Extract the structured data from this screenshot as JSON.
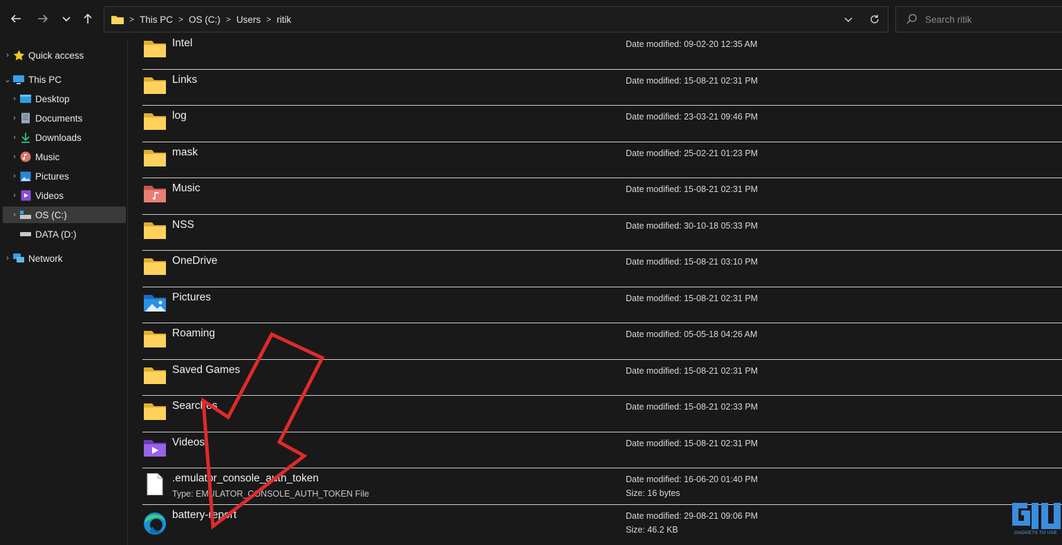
{
  "address": {
    "crumbs": [
      "This PC",
      "OS (C:)",
      "Users",
      "ritik"
    ]
  },
  "search": {
    "placeholder": "Search ritik"
  },
  "sidebar": {
    "quick_access": "Quick access",
    "this_pc": "This PC",
    "desktop": "Desktop",
    "documents": "Documents",
    "downloads": "Downloads",
    "music": "Music",
    "pictures": "Pictures",
    "videos": "Videos",
    "os_c": "OS (C:)",
    "data_d": "DATA (D:)",
    "network": "Network"
  },
  "files": [
    {
      "name": "Intel",
      "icon": "folder-icon",
      "date": "Date modified: 09-02-20 12:35 AM"
    },
    {
      "name": "Links",
      "icon": "folder-icon",
      "date": "Date modified: 15-08-21 02:31 PM"
    },
    {
      "name": "log",
      "icon": "folder-icon",
      "date": "Date modified: 23-03-21 09:46 PM"
    },
    {
      "name": "mask",
      "icon": "folder-icon",
      "date": "Date modified: 25-02-21 01:23 PM"
    },
    {
      "name": "Music",
      "icon": "music-folder-icon",
      "date": "Date modified: 15-08-21 02:31 PM"
    },
    {
      "name": "NSS",
      "icon": "folder-icon",
      "date": "Date modified: 30-10-18 05:33 PM"
    },
    {
      "name": "OneDrive",
      "icon": "folder-icon",
      "date": "Date modified: 15-08-21 03:10 PM"
    },
    {
      "name": "Pictures",
      "icon": "pictures-folder-icon",
      "date": "Date modified: 15-08-21 02:31 PM"
    },
    {
      "name": "Roaming",
      "icon": "folder-icon",
      "date": "Date modified: 05-05-18 04:26 AM"
    },
    {
      "name": "Saved Games",
      "icon": "folder-icon",
      "date": "Date modified: 15-08-21 02:31 PM"
    },
    {
      "name": "Searches",
      "icon": "folder-icon",
      "date": "Date modified: 15-08-21 02:33 PM"
    },
    {
      "name": "Videos",
      "icon": "videos-folder-icon",
      "date": "Date modified: 15-08-21 02:31 PM"
    },
    {
      "name": ".emulator_console_auth_token",
      "icon": "file-icon",
      "date": "Date modified: 16-06-20 01:40 PM",
      "type": "Type: EMULATOR_CONSOLE_AUTH_TOKEN File",
      "size": "Size: 16 bytes"
    },
    {
      "name": "battery-report",
      "icon": "edge-icon",
      "date": "Date modified: 29-08-21 09:06 PM",
      "size": "Size: 46.2 KB"
    }
  ],
  "colors": {
    "folder": "#f3c24b",
    "arrow": "#e02a2a",
    "background": "#191919"
  },
  "watermark": {
    "text": "GADGETS TO USE"
  }
}
